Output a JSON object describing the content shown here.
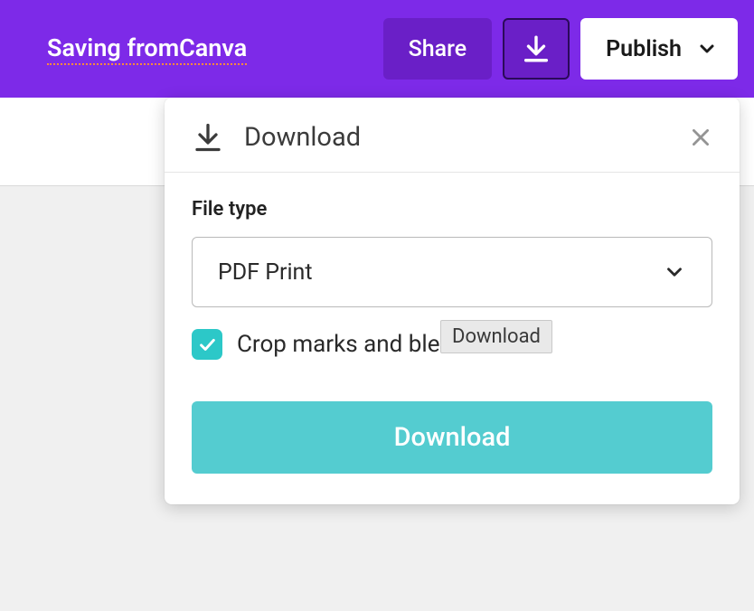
{
  "topbar": {
    "title": "Saving fromCanva",
    "share_label": "Share",
    "publish_label": "Publish"
  },
  "popover": {
    "title": "Download",
    "file_type_label": "File type",
    "selected_file_type": "PDF Print",
    "crop_label": "Crop marks and bleed",
    "download_button": "Download"
  },
  "tooltip": {
    "text": "Download"
  }
}
